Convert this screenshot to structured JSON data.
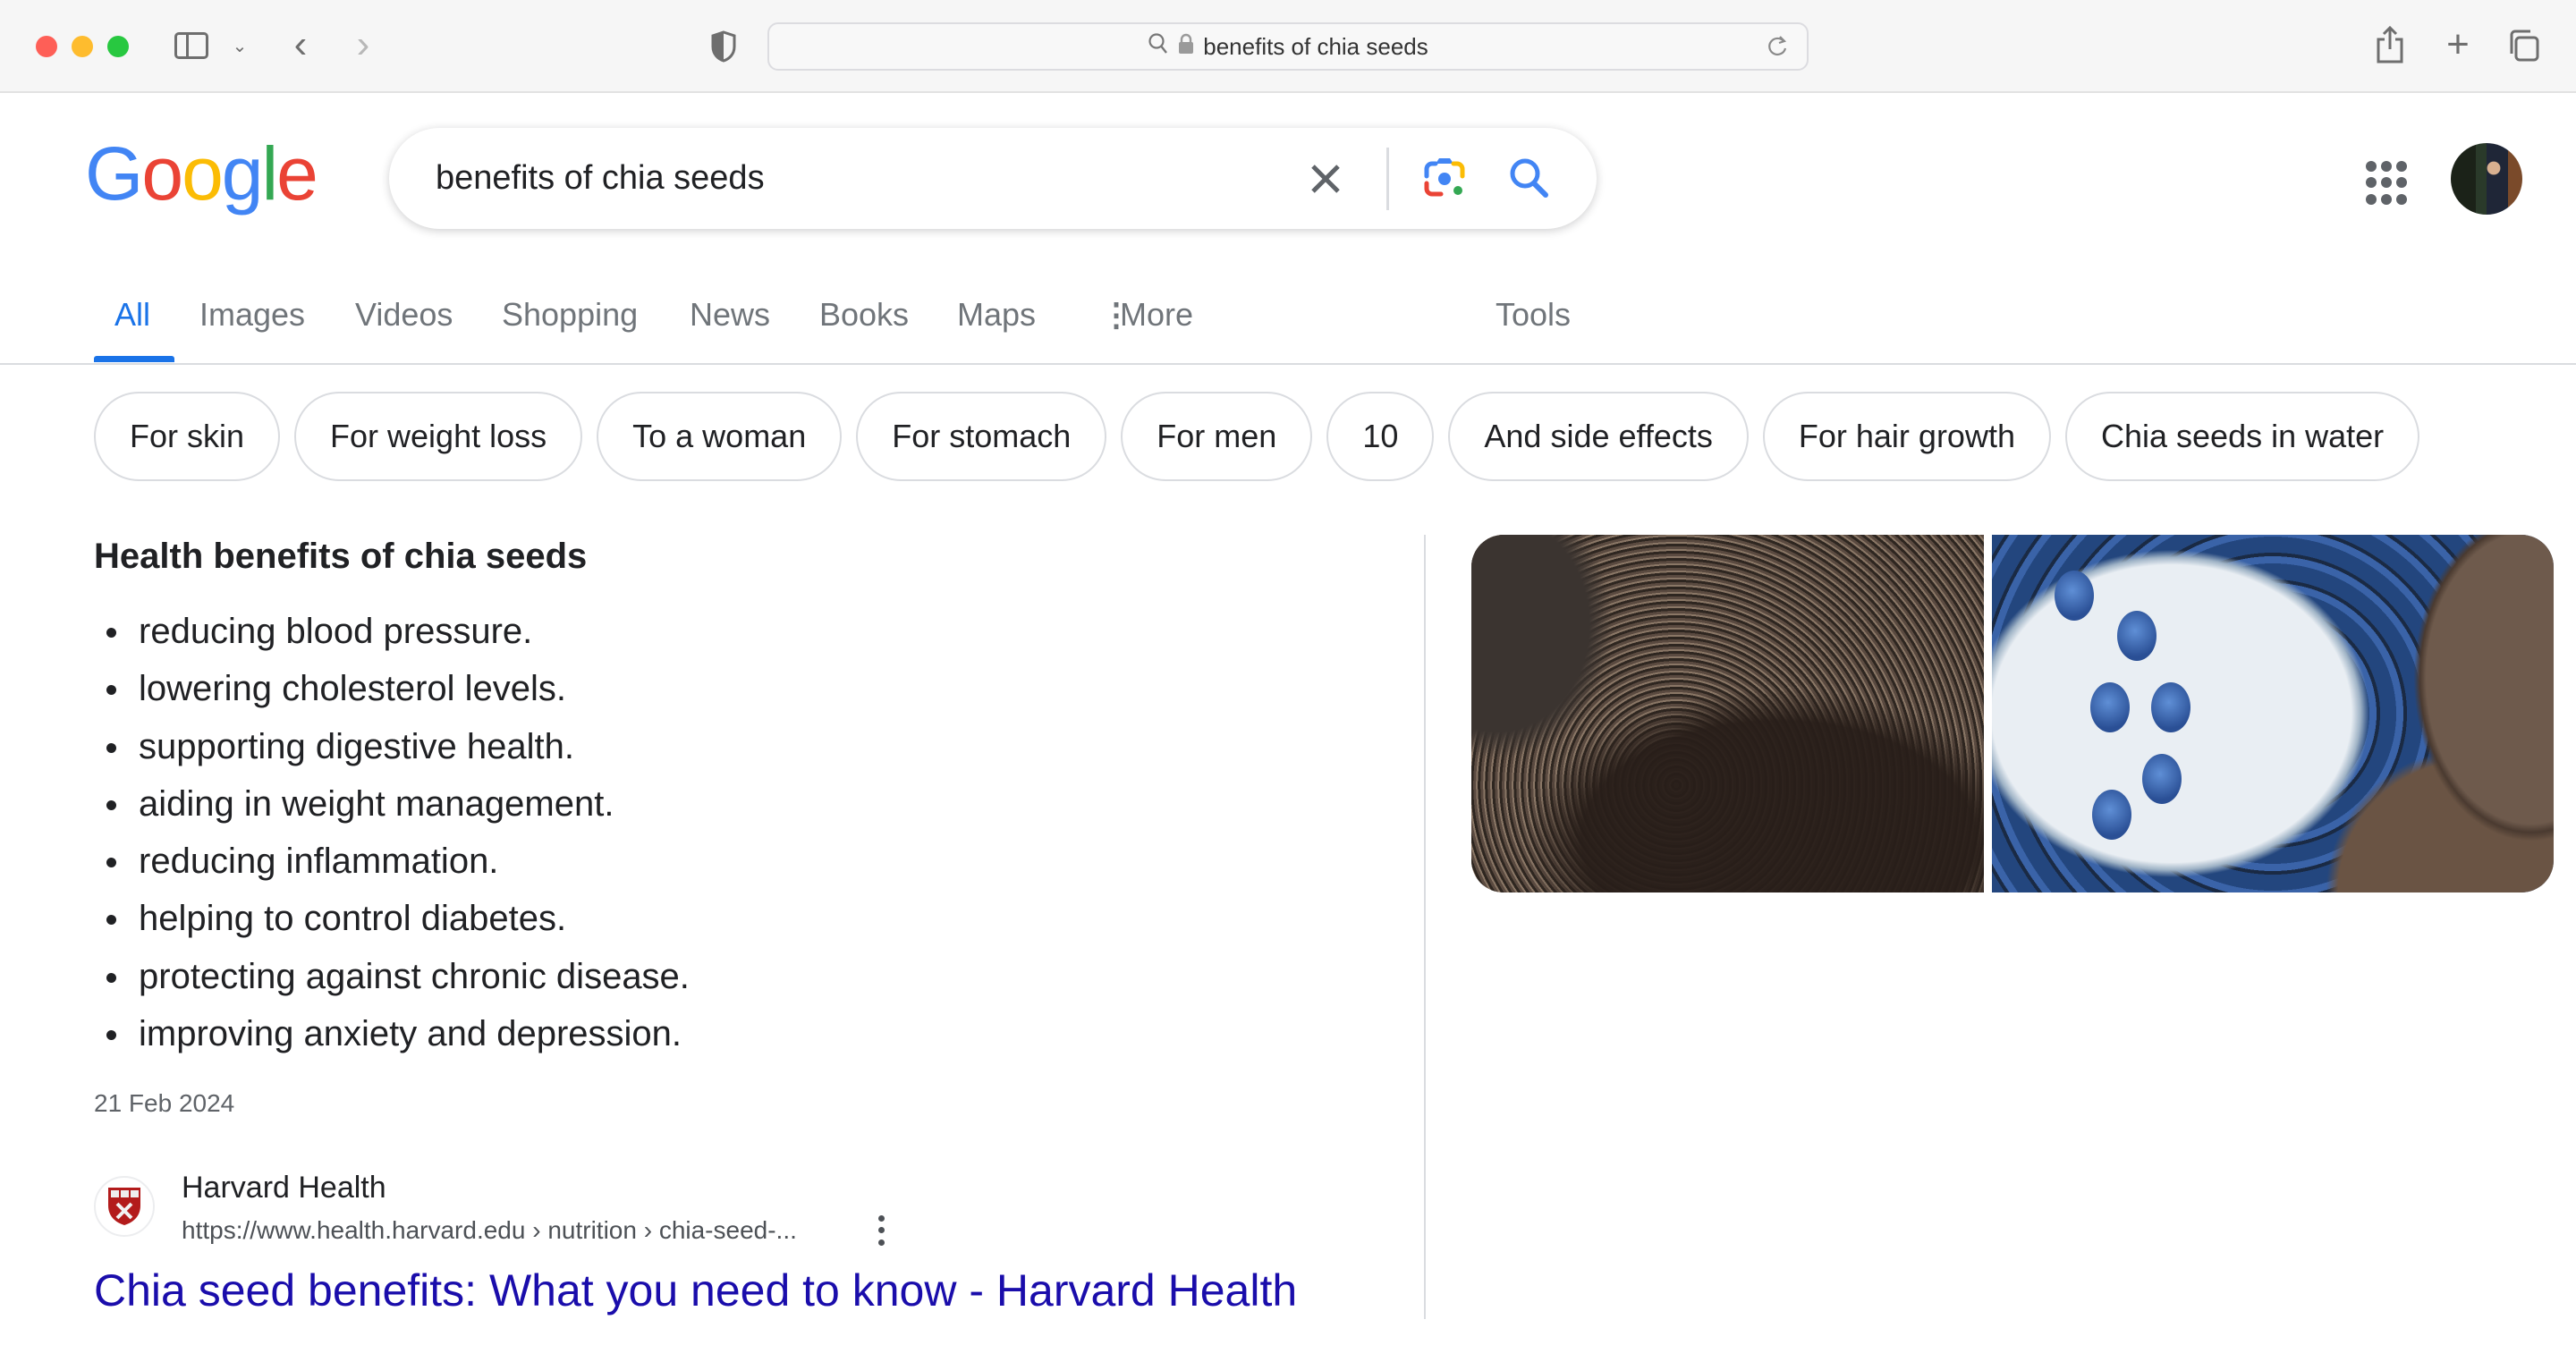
{
  "browser": {
    "url_display": "benefits of chia seeds",
    "icons": {
      "sidebar": "sidebar-icon",
      "back": "chevron-left-icon",
      "forward": "chevron-right-icon",
      "privacy": "shield-icon",
      "search": "magnifier-icon",
      "lock": "lock-icon",
      "reload": "reload-icon",
      "share": "share-icon",
      "new_tab": "plus-icon",
      "tabs_overview": "tabs-icon"
    },
    "glyphs": {
      "back": "‹",
      "forward": "›",
      "chevron_down": "⌄",
      "plus": "+"
    }
  },
  "header": {
    "logo": [
      "G",
      "o",
      "o",
      "g",
      "l",
      "e"
    ],
    "logo_colors": [
      "#4285F4",
      "#EA4335",
      "#FBBC05",
      "#4285F4",
      "#34A853",
      "#EA4335"
    ],
    "search_query": "benefits of chia seeds"
  },
  "nav": {
    "tabs": [
      {
        "label": "All",
        "active": true
      },
      {
        "label": "Images"
      },
      {
        "label": "Videos"
      },
      {
        "label": "Shopping"
      },
      {
        "label": "News"
      },
      {
        "label": "Books"
      },
      {
        "label": "Maps"
      },
      {
        "label": "More"
      }
    ],
    "more_glyph": "⋮",
    "tools": "Tools"
  },
  "chips": [
    "For skin",
    "For weight loss",
    "To a woman",
    "For stomach",
    "For men",
    "10",
    "And side effects",
    "For hair growth",
    "Chia seeds in water"
  ],
  "snippet": {
    "title": "Health benefits of chia seeds",
    "items": [
      "reducing blood pressure.",
      "lowering cholesterol levels.",
      "supporting digestive health.",
      "aiding in weight management.",
      "reducing inflammation.",
      "helping to control diabetes.",
      "protecting against chronic disease.",
      "improving anxiety and depression."
    ],
    "date": "21 Feb 2024"
  },
  "result": {
    "site_name": "Harvard Health",
    "url": "https://www.health.harvard.edu › nutrition › chia-seed-...",
    "title": "Chia seed benefits: What you need to know - Harvard Health"
  },
  "images": [
    {
      "alt": "chia seeds in wooden spoon"
    },
    {
      "alt": "chia pudding with blueberries"
    }
  ],
  "colors": {
    "accent_blue": "#1a73e8",
    "link": "#1a0dab",
    "text": "#202124",
    "muted": "#70757a"
  }
}
